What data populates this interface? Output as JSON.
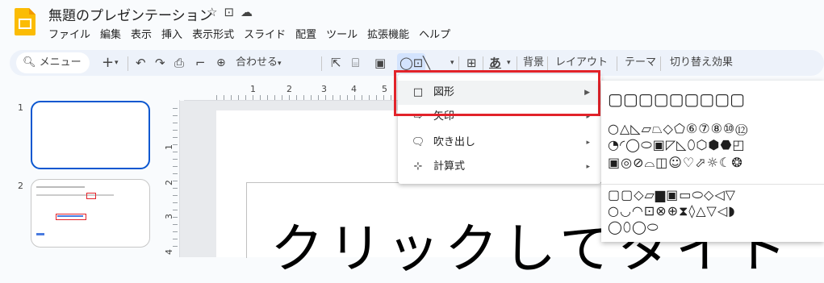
{
  "doc": {
    "title": "無題のプレゼンテーション",
    "menus": [
      "ファイル",
      "編集",
      "表示",
      "挿入",
      "表示形式",
      "スライド",
      "配置",
      "ツール",
      "拡張機能",
      "ヘルプ"
    ]
  },
  "toolbar": {
    "menu_search": "メニュー",
    "zoom_label": "合わせる",
    "background": "背景",
    "layout": "レイアウト",
    "theme": "テーマ",
    "transition": "切り替え効果",
    "text_style": "あ"
  },
  "slides": [
    {
      "number": "1"
    },
    {
      "number": "2"
    }
  ],
  "ruler": {
    "top_ticks": [
      "1",
      "2",
      "3",
      "4",
      "5"
    ],
    "left_ticks": [
      "1",
      "2",
      "3",
      "4"
    ]
  },
  "canvas": {
    "big_text": "クリックしてタイト"
  },
  "shape_menu": {
    "items": [
      {
        "icon": "□",
        "label": "図形"
      },
      {
        "icon": "⇨",
        "label": "矢印"
      },
      {
        "icon": "🗨",
        "label": "吹き出し"
      },
      {
        "icon": "⊹",
        "label": "計算式"
      }
    ]
  },
  "shapes_panel": {
    "rows": [
      "▢▢▢▢▢▢▢▢▢",
      "○△◺▱⏢◇⬠⑥⑦⑧⑩⑫",
      "◔◜◯⬭▣◸◺⬯⬡⬢⬣◰",
      "▣◎⊘⌓◫☺♡⬀☼☾❂",
      "▢▢◇▱▆▣▭⬭◇◁▽",
      "○◡◠⊡⊗⊕⧗◊△▽◁◗",
      "◯⬯◯⬭"
    ]
  }
}
